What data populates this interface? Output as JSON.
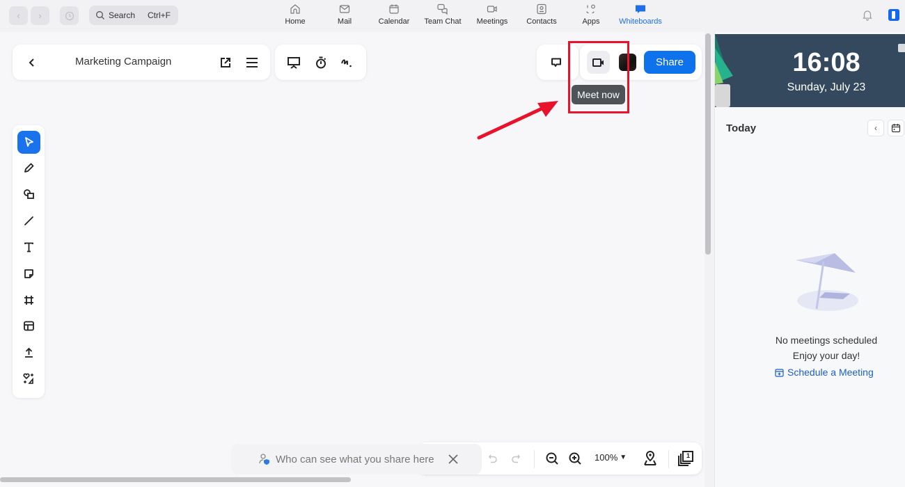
{
  "topbar": {
    "search_label": "Search",
    "search_shortcut": "Ctrl+F",
    "tabs": [
      {
        "label": "Home",
        "icon": "home-icon"
      },
      {
        "label": "Mail",
        "icon": "mail-icon"
      },
      {
        "label": "Calendar",
        "icon": "calendar-icon"
      },
      {
        "label": "Team Chat",
        "icon": "chat-icon"
      },
      {
        "label": "Meetings",
        "icon": "video-icon"
      },
      {
        "label": "Contacts",
        "icon": "contacts-icon"
      },
      {
        "label": "Apps",
        "icon": "apps-icon"
      },
      {
        "label": "Whiteboards",
        "icon": "whiteboard-icon",
        "active": true
      }
    ],
    "accent_color": "#1e6fe8"
  },
  "whiteboard": {
    "title": "Marketing Campaign",
    "share_label": "Share",
    "tooltip": "Meet now",
    "privacy_notice": "Who can see what you share here",
    "zoom_level": "100%",
    "page_count": "1",
    "tools": [
      "select",
      "pen",
      "shapes",
      "line",
      "text",
      "sticky-note",
      "frame",
      "template",
      "upload",
      "ai-assist"
    ]
  },
  "sidebar": {
    "time": "16:08",
    "date": "Sunday, July 23",
    "today_label": "Today",
    "empty_title": "No meetings scheduled",
    "empty_subtitle": "Enjoy your day!",
    "schedule_link": "Schedule a Meeting"
  }
}
